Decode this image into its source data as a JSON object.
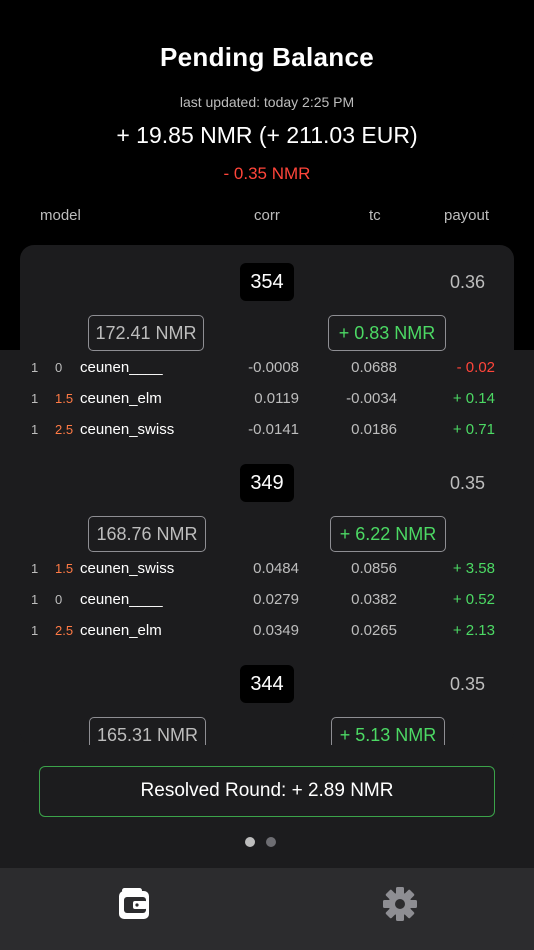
{
  "header": {
    "title": "Pending Balance",
    "last_updated": "last updated: today 2:25 PM",
    "balance": "+ 19.85 NMR (+ 211.03 EUR)",
    "delta": "- 0.35 NMR"
  },
  "columns": {
    "model": "model",
    "corr": "corr",
    "tc": "tc",
    "payout": "payout"
  },
  "rounds": [
    {
      "number": "354",
      "value": "0.36",
      "stake": "172.41 NMR",
      "payout": "+ 0.83 NMR",
      "rows": [
        {
          "idx": "1",
          "mult": "0",
          "name": "ceunen____",
          "corr": "-0.0008",
          "tc": "0.0688",
          "pay": "- 0.02"
        },
        {
          "idx": "1",
          "mult": "1.5",
          "name": "ceunen_elm",
          "corr": "0.0119",
          "tc": "-0.0034",
          "pay": "+ 0.14"
        },
        {
          "idx": "1",
          "mult": "2.5",
          "name": "ceunen_swiss",
          "corr": "-0.0141",
          "tc": "0.0186",
          "pay": "+ 0.71"
        }
      ]
    },
    {
      "number": "349",
      "value": "0.35",
      "stake": "168.76 NMR",
      "payout": "+ 6.22 NMR",
      "rows": [
        {
          "idx": "1",
          "mult": "1.5",
          "name": "ceunen_swiss",
          "corr": "0.0484",
          "tc": "0.0856",
          "pay": "+ 3.58"
        },
        {
          "idx": "1",
          "mult": "0",
          "name": "ceunen____",
          "corr": "0.0279",
          "tc": "0.0382",
          "pay": "+ 0.52"
        },
        {
          "idx": "1",
          "mult": "2.5",
          "name": "ceunen_elm",
          "corr": "0.0349",
          "tc": "0.0265",
          "pay": "+ 2.13"
        }
      ]
    },
    {
      "number": "344",
      "value": "0.35",
      "stake": "165.31 NMR",
      "payout": "+ 5.13 NMR"
    }
  ],
  "resolved": "Resolved Round: + 2.89 NMR",
  "tabs": {
    "wallet_icon": "wallet-icon",
    "settings_icon": "gear-icon"
  },
  "colors": {
    "positive": "#4cd964",
    "negative": "#ff453a",
    "multiplier": "#ff7a45"
  }
}
